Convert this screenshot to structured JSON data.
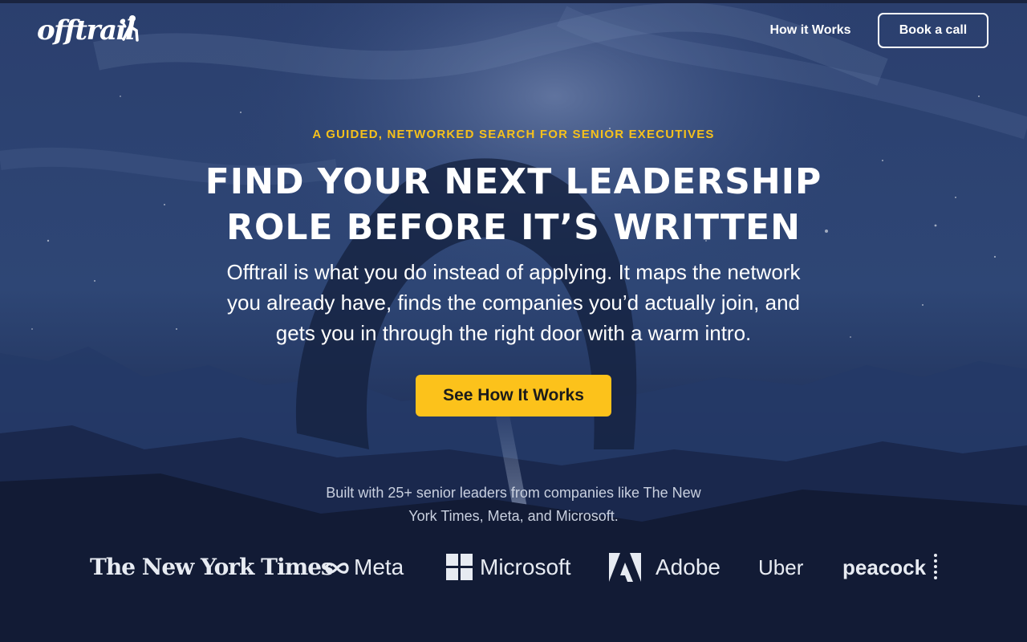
{
  "brand": {
    "logo_text": "offtrail"
  },
  "nav": {
    "how_it_works": "How it Works",
    "book_call": "Book a call"
  },
  "hero": {
    "eyebrow": "A GUIDED, NETWORKED SEARCH FOR SENIOR EXECUTIVES",
    "headline_line1": "FIND YOUR NEXT LEADERSHIP",
    "headline_line2": "ROLE BEFORE IT’S WRITTEN",
    "subtext_line1": "Offtrail is what you do instead of applying. It maps the network",
    "subtext_line2": "you already have, finds the companies you’d actually join, and",
    "subtext_line3": "gets you in through the right door with a warm intro.",
    "cta": "See How It Works"
  },
  "social_proof": {
    "text_line1": "Built with 25+ senior leaders from companies like The New",
    "text_line2": "York Times, Meta, and Microsoft.",
    "companies": [
      "The New York Times",
      "Meta",
      "Microsoft",
      "Adobe",
      "Uber",
      "peacock"
    ]
  },
  "colors": {
    "accent": "#fcc21b",
    "eyebrow": "#f6c11b",
    "background": "#1b2a4f",
    "text": "#ffffff"
  }
}
